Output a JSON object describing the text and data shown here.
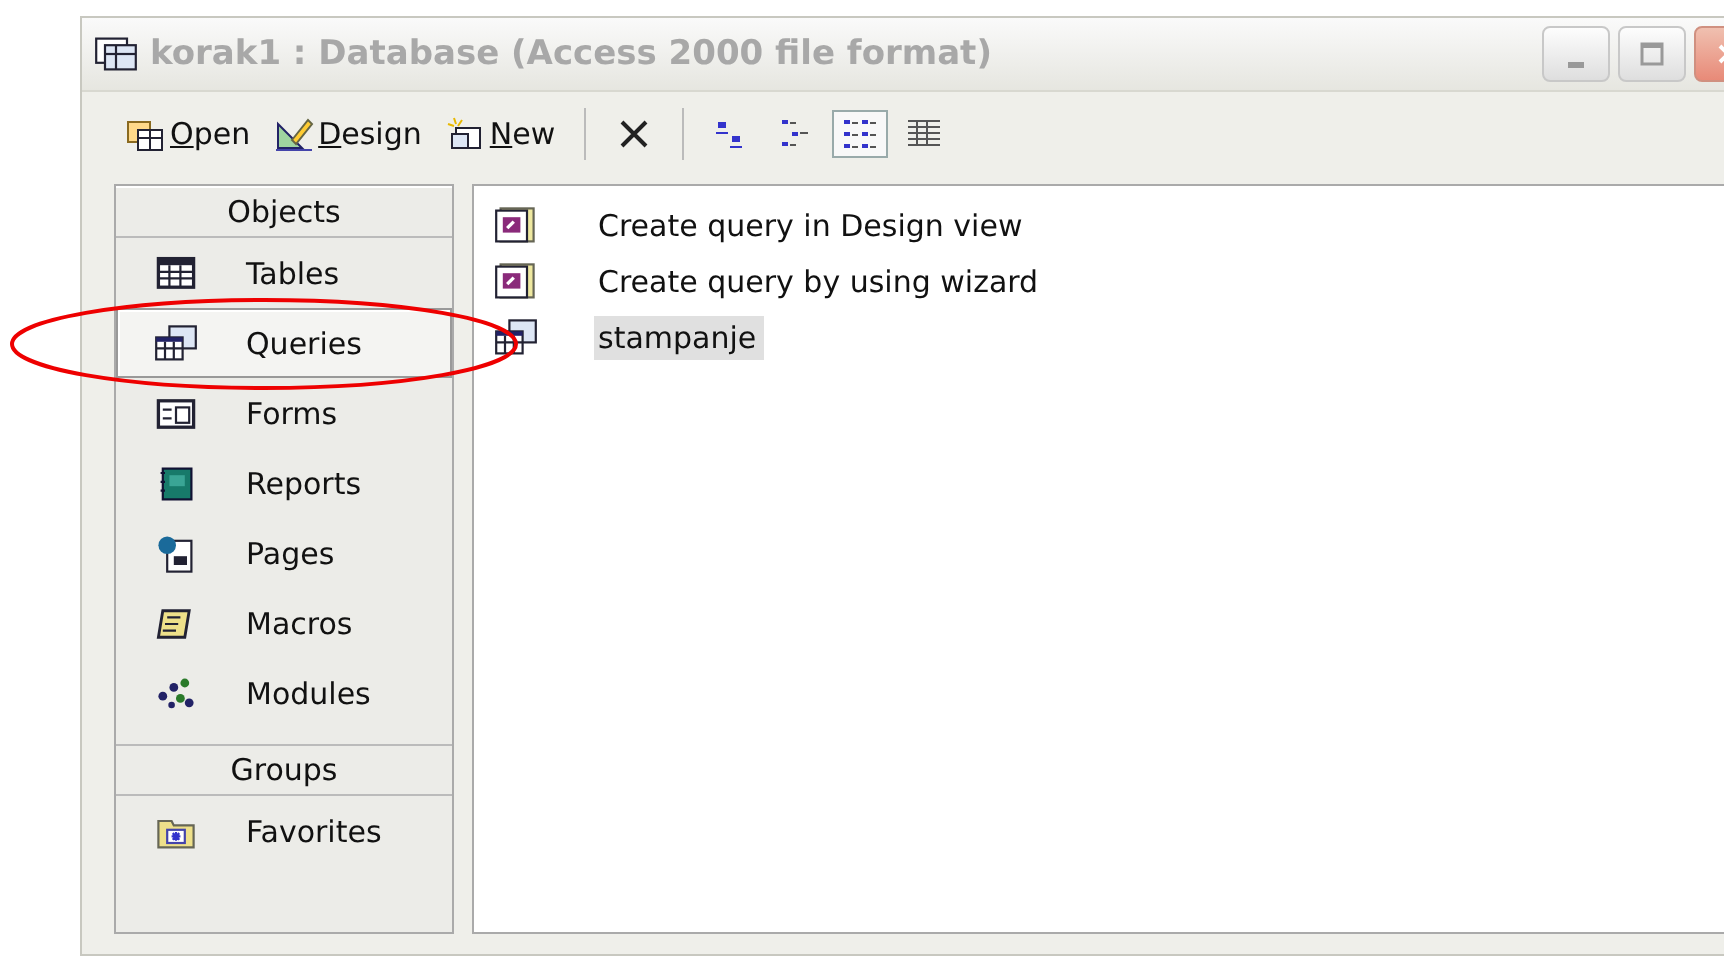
{
  "window": {
    "title": "korak1 : Database (Access 2000 file format)",
    "active": false
  },
  "toolbar": {
    "buttons": [
      {
        "label": "Open",
        "kind": "open"
      },
      {
        "label": "Design",
        "kind": "design"
      },
      {
        "label": "New",
        "kind": "new"
      }
    ],
    "views": [
      {
        "kind": "large",
        "selected": false
      },
      {
        "kind": "small",
        "selected": false
      },
      {
        "kind": "list",
        "selected": true
      },
      {
        "kind": "details",
        "selected": false
      }
    ]
  },
  "sidebar": {
    "sections": [
      {
        "header": "Objects",
        "items": [
          {
            "label": "Tables",
            "kind": "table",
            "selected": false
          },
          {
            "label": "Queries",
            "kind": "query",
            "selected": true
          },
          {
            "label": "Forms",
            "kind": "form",
            "selected": false
          },
          {
            "label": "Reports",
            "kind": "report",
            "selected": false
          },
          {
            "label": "Pages",
            "kind": "page",
            "selected": false
          },
          {
            "label": "Macros",
            "kind": "macro",
            "selected": false
          },
          {
            "label": "Modules",
            "kind": "module",
            "selected": false
          }
        ]
      },
      {
        "header": "Groups",
        "items": [
          {
            "label": "Favorites",
            "kind": "favorites",
            "selected": false
          }
        ]
      }
    ]
  },
  "objects": [
    {
      "label": "Create query in Design view",
      "kind": "shortcut",
      "selected": false
    },
    {
      "label": "Create query by using wizard",
      "kind": "shortcut",
      "selected": false
    },
    {
      "label": "stampanje",
      "kind": "query",
      "selected": true
    }
  ]
}
